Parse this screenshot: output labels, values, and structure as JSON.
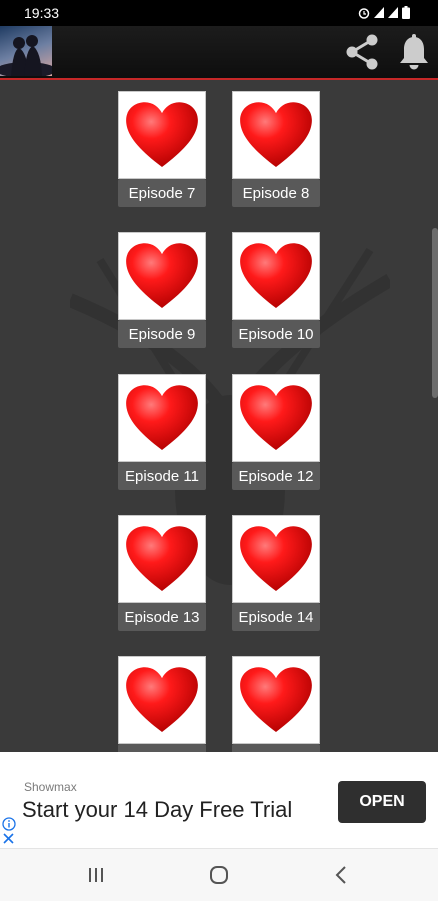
{
  "status_bar": {
    "time": "19:33"
  },
  "app_bar": {
    "logo_icon": "couple-logo-icon",
    "share_icon": "share-icon",
    "notifications_icon": "bell-icon"
  },
  "episodes": [
    {
      "label": "Episode 7"
    },
    {
      "label": "Episode 8"
    },
    {
      "label": "Episode 9"
    },
    {
      "label": "Episode 10"
    },
    {
      "label": "Episode 11"
    },
    {
      "label": "Episode 12"
    },
    {
      "label": "Episode 13"
    },
    {
      "label": "Episode 14"
    },
    {
      "label": ""
    },
    {
      "label": ""
    }
  ],
  "ad": {
    "advertiser": "Showmax",
    "headline": "Start your 14 Day Free Trial",
    "cta": "OPEN"
  },
  "nav_bar": {
    "recents_icon": "recents-icon",
    "home_icon": "home-icon",
    "back_icon": "back-icon"
  },
  "colors": {
    "accent_red": "#c62828",
    "background": "#3a3a3a",
    "label_bg": "#595959",
    "heart_red": "#ee1111"
  }
}
